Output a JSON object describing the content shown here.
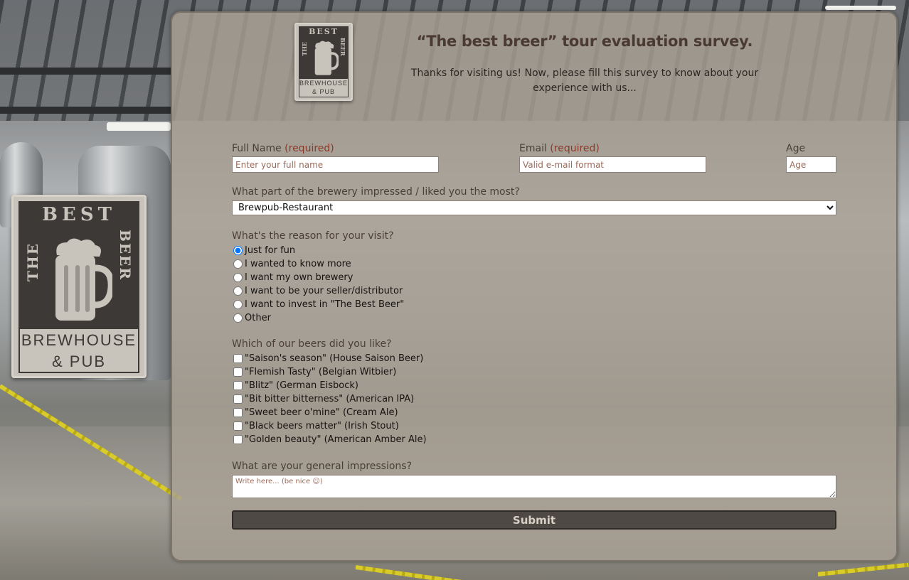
{
  "logo": {
    "word_best": "BEST",
    "word_the": "THE",
    "word_beer": "BEER",
    "brewhouse": "BREWHOUSE",
    "pub": "& PUB"
  },
  "header": {
    "title": "“The best breer” tour evaluation survey.",
    "subtitle": "Thanks for visiting us! Now, please fill this survey to know about your experience with us..."
  },
  "form": {
    "full_name_label": "Full Name",
    "full_name_required": "(required)",
    "full_name_placeholder": "Enter your full name",
    "email_label": "Email",
    "email_required": "(required)",
    "email_placeholder": "Valid e-mail format",
    "age_label": "Age",
    "age_placeholder": "Age",
    "part_label": "What part of the brewery impressed / liked you the most?",
    "part_selected": "Brewpub-Restaurant",
    "reason_label": "What's the reason for your visit?",
    "reasons": [
      "Just for fun",
      "I wanted to know more",
      "I want my own brewery",
      "I want to be your seller/distributor",
      "I want to invest in \"The Best Beer\"",
      "Other"
    ],
    "reason_selected_index": 0,
    "beers_label": "Which of our beers did you like?",
    "beers": [
      "\"Saison's season\" (House Saison Beer)",
      "\"Flemish Tasty\" (Belgian Witbier)",
      "\"Blitz\" (German Eisbock)",
      "\"Bit bitter bitterness\" (American IPA)",
      "\"Sweet beer o'mine\" (Cream Ale)",
      "\"Black beers matter\" (Irish Stout)",
      "\"Golden beauty\" (American Amber Ale)"
    ],
    "impressions_label": "What are your general impressions?",
    "impressions_placeholder": "Write here... (be nice ☺)",
    "submit_label": "Submit"
  }
}
